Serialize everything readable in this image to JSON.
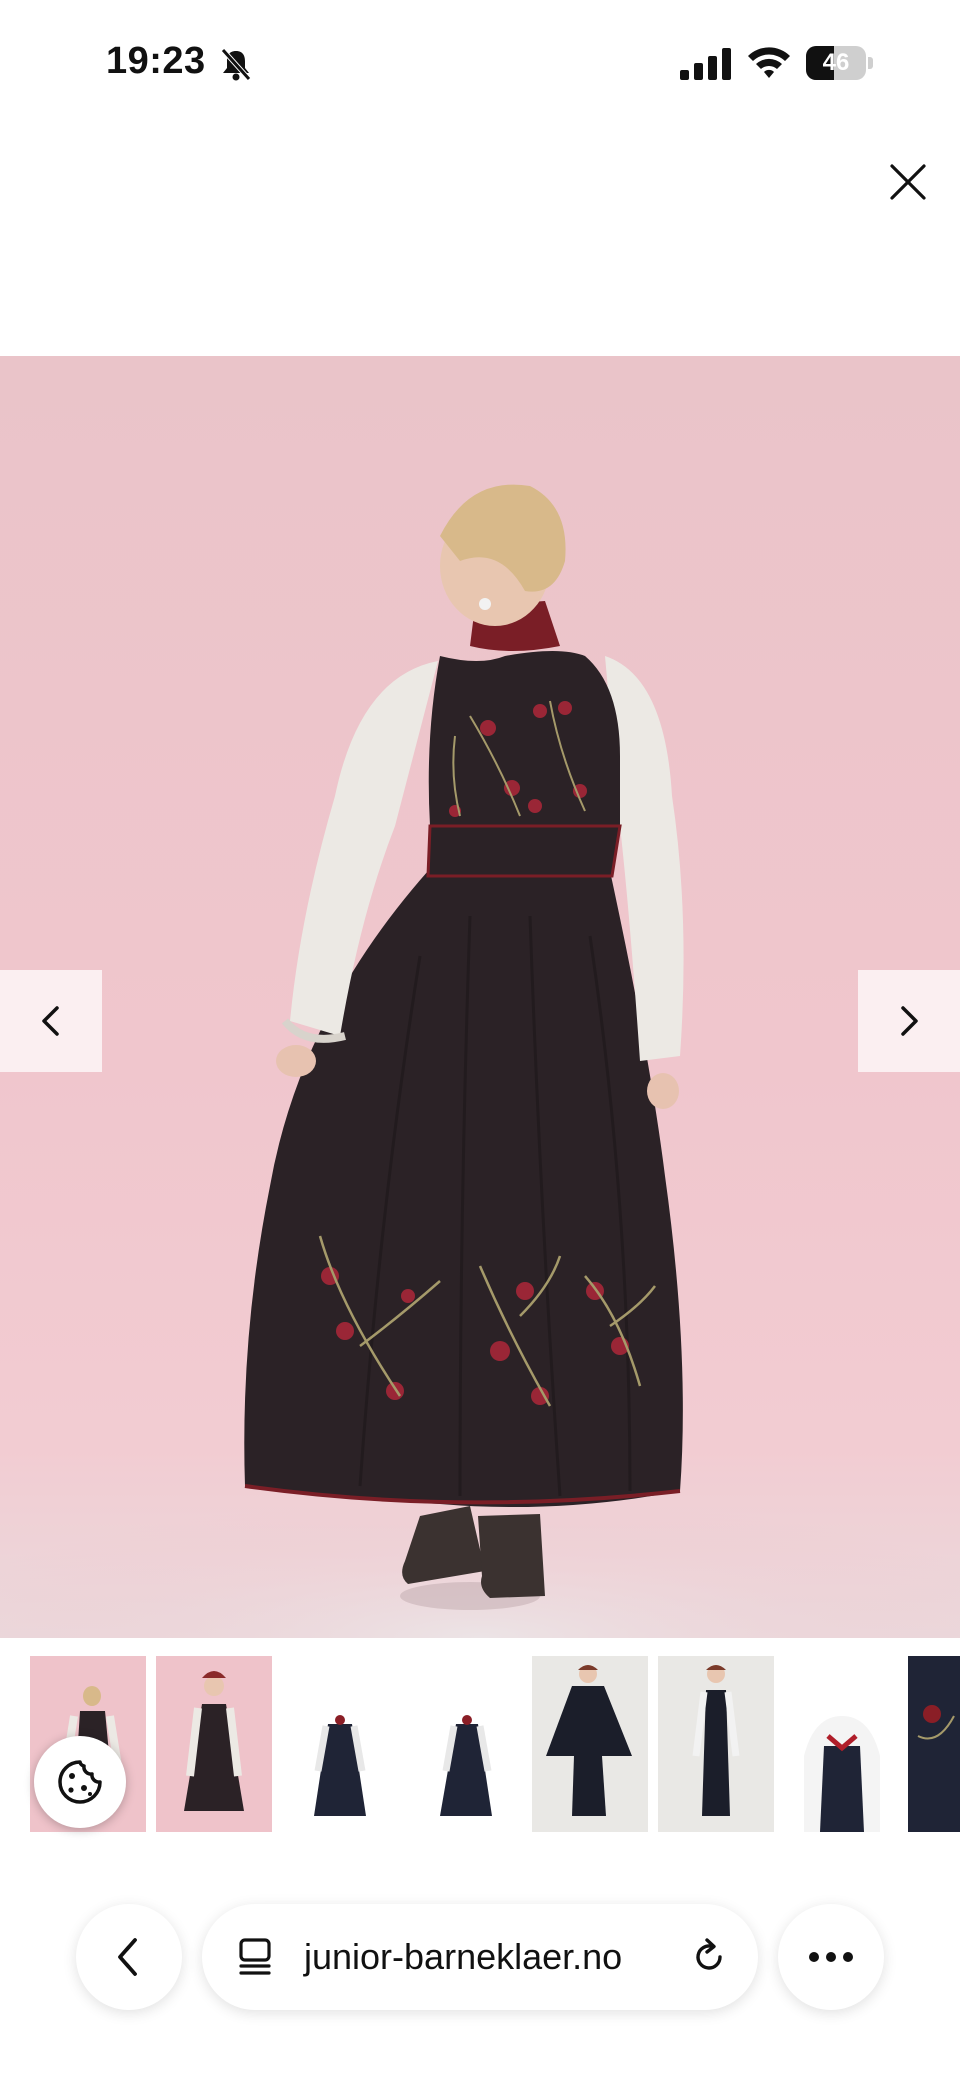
{
  "status_bar": {
    "time": "19:23",
    "silent_icon": "bell-slash-icon",
    "signal_icon": "cellular-signal-icon",
    "wifi_icon": "wifi-icon",
    "battery_level": "46",
    "battery_fraction": 0.46
  },
  "viewer": {
    "close_icon": "close-icon",
    "prev_icon": "chevron-left-icon",
    "next_icon": "chevron-right-icon",
    "background_color": "#f0c6cd"
  },
  "thumbnails": [
    {
      "kind": "pink-back"
    },
    {
      "kind": "pink-front"
    },
    {
      "kind": "white-front"
    },
    {
      "kind": "white-front-2"
    },
    {
      "kind": "grey-cape"
    },
    {
      "kind": "grey-front"
    },
    {
      "kind": "white-bodice"
    },
    {
      "kind": "dark-embroidery"
    }
  ],
  "cookie_icon": "cookie-icon",
  "browser": {
    "url": "junior-barneklaer.no",
    "back_icon": "chevron-left-icon",
    "tab_icon": "tabs-icon",
    "reload_icon": "reload-icon",
    "more_icon": "more-horizontal-icon"
  }
}
